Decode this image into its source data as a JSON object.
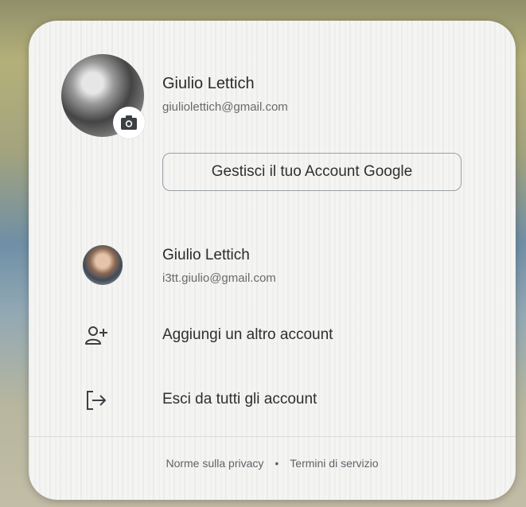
{
  "primary_account": {
    "name": "Giulio Lettich",
    "email": "giuliolettich@gmail.com",
    "manage_label": "Gestisci il tuo Account Google"
  },
  "secondary_account": {
    "name": "Giulio Lettich",
    "email": "i3tt.giulio@gmail.com"
  },
  "menu": {
    "add_account": "Aggiungi un altro account",
    "sign_out_all": "Esci da tutti gli account"
  },
  "footer": {
    "privacy": "Norme sulla privacy",
    "separator": "•",
    "terms": "Termini di servizio"
  },
  "icons": {
    "camera": "camera-icon",
    "add_person": "person-add-icon",
    "logout": "logout-icon"
  }
}
